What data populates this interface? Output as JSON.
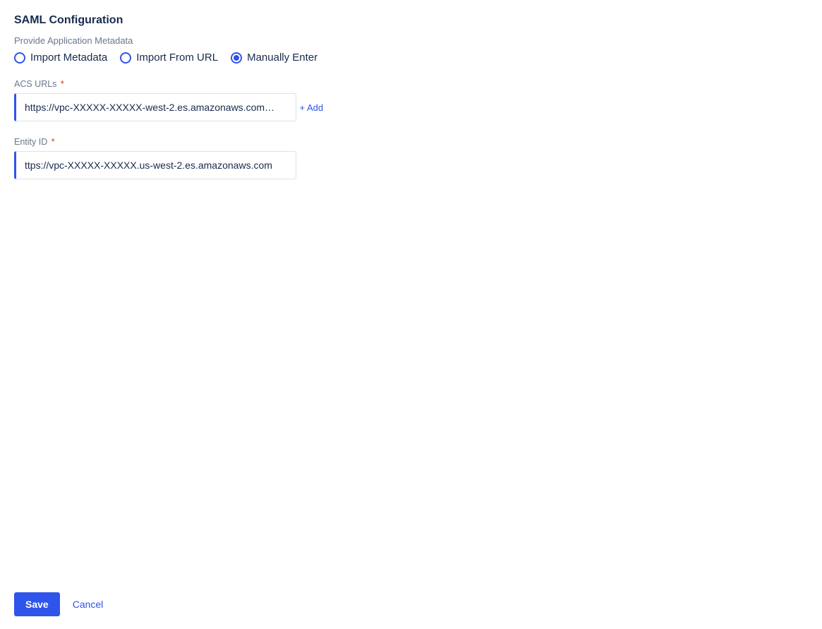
{
  "heading": "SAML Configuration",
  "subtext": "Provide Application Metadata",
  "radio_options": {
    "import_metadata": "Import Metadata",
    "import_from_url": "Import From URL",
    "manually_enter": "Manually Enter"
  },
  "selected_option": "manually_enter",
  "fields": {
    "acs_urls": {
      "label": "ACS URLs",
      "required": "*",
      "value": "https://vpc-XXXXX-XXXXX-west-2.es.amazonaws.com…",
      "add_label": "+ Add"
    },
    "entity_id": {
      "label": "Entity ID",
      "required": "*",
      "value": "ttps://vpc-XXXXX-XXXXX.us-west-2.es.amazonaws.com"
    }
  },
  "footer": {
    "save": "Save",
    "cancel": "Cancel"
  }
}
